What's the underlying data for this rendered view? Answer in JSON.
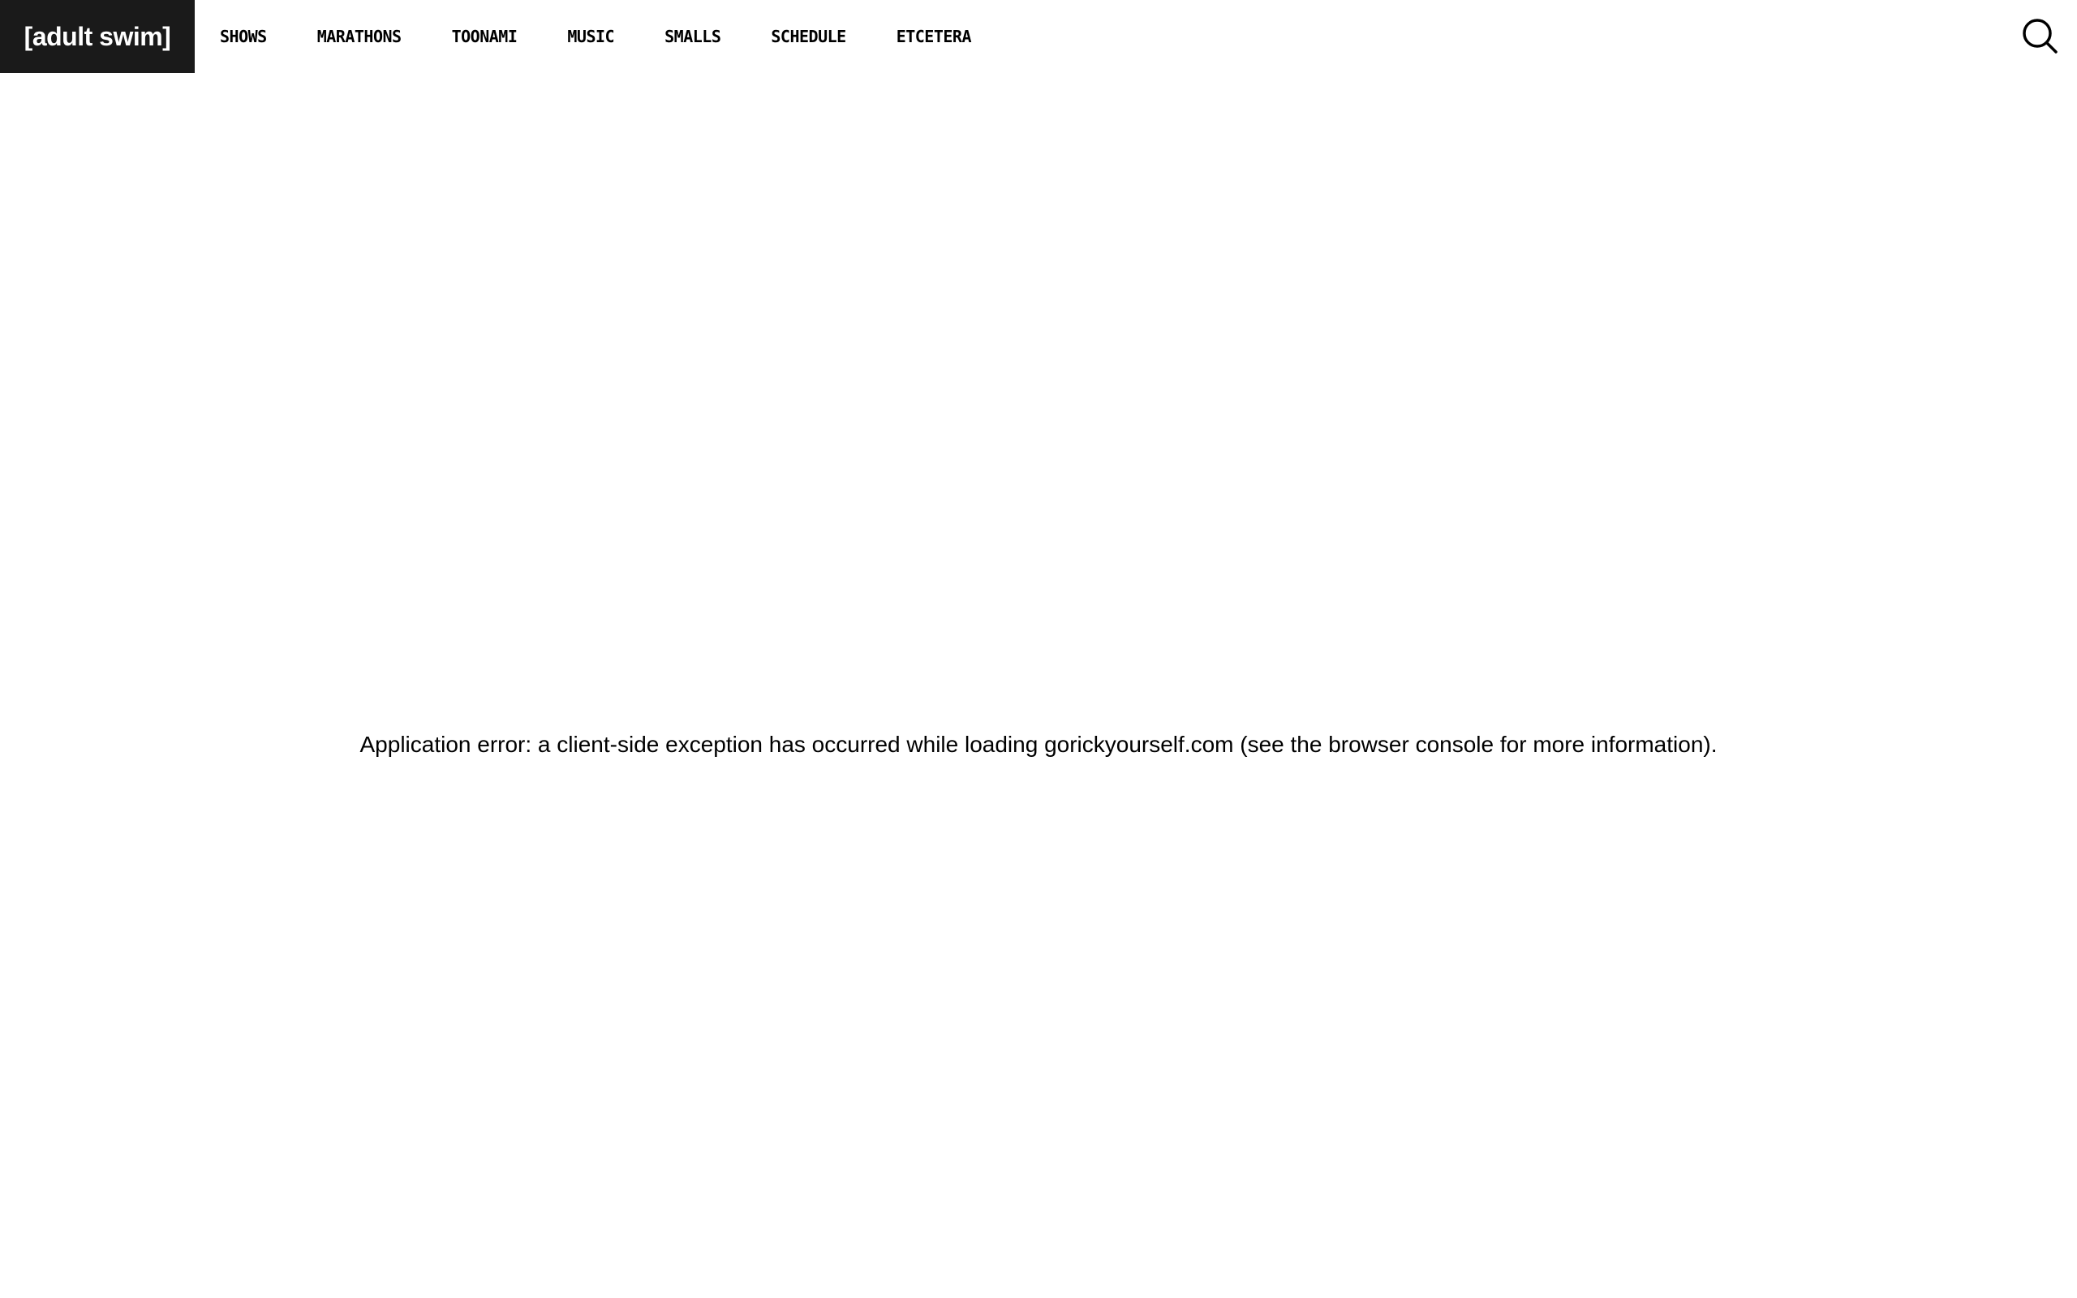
{
  "header": {
    "logo": "[adult swim]",
    "nav": [
      {
        "label": "SHOWS"
      },
      {
        "label": "MARATHONS"
      },
      {
        "label": "TOONAMI"
      },
      {
        "label": "MUSIC"
      },
      {
        "label": "SMALLS"
      },
      {
        "label": "SCHEDULE"
      },
      {
        "label": "ETCETERA"
      }
    ],
    "search_icon": "search-icon"
  },
  "main": {
    "error_text": "Application error: a client-side exception has occurred while loading gorickyourself.com (see the browser console for more information)."
  },
  "colors": {
    "logo_bg": "#1a1a1a",
    "logo_text": "#ffffff",
    "page_bg": "#ffffff",
    "text": "#000000"
  }
}
